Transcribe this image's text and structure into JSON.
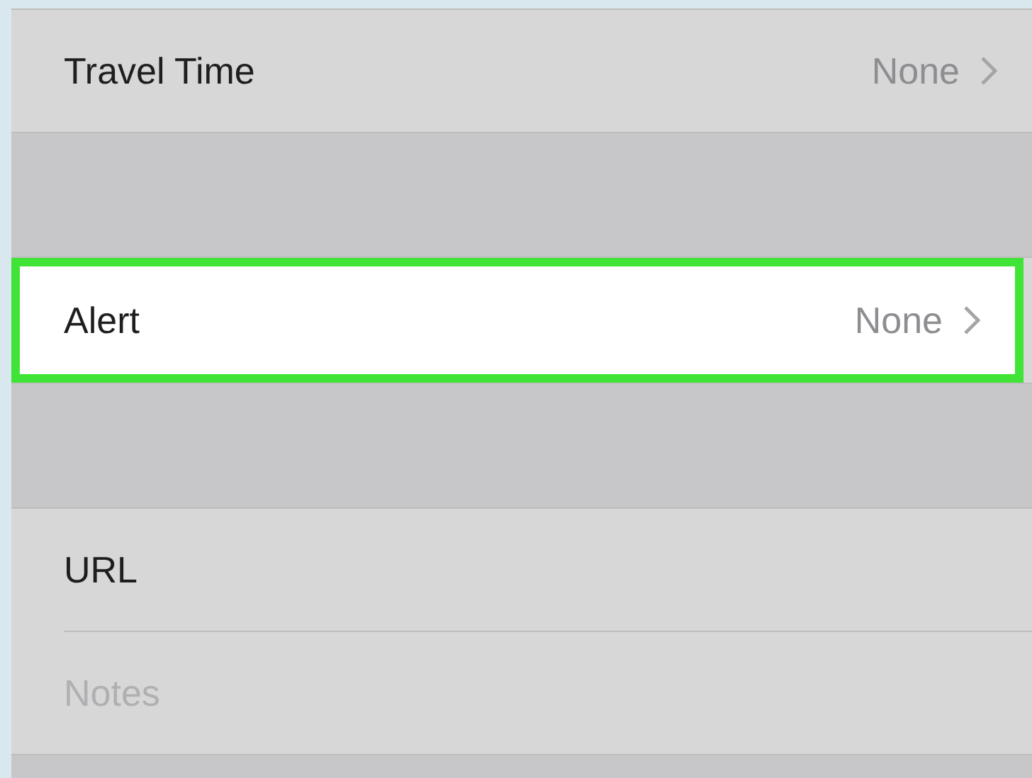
{
  "sections": [
    {
      "rows": [
        {
          "kind": "disclosure",
          "label": "Travel Time",
          "value": "None",
          "highlighted": false
        }
      ]
    },
    {
      "rows": [
        {
          "kind": "disclosure",
          "label": "Alert",
          "value": "None",
          "highlighted": true
        }
      ]
    },
    {
      "rows": [
        {
          "kind": "label",
          "label": "URL",
          "highlighted": false
        },
        {
          "kind": "placeholder",
          "label": "Notes",
          "highlighted": false
        }
      ]
    }
  ]
}
